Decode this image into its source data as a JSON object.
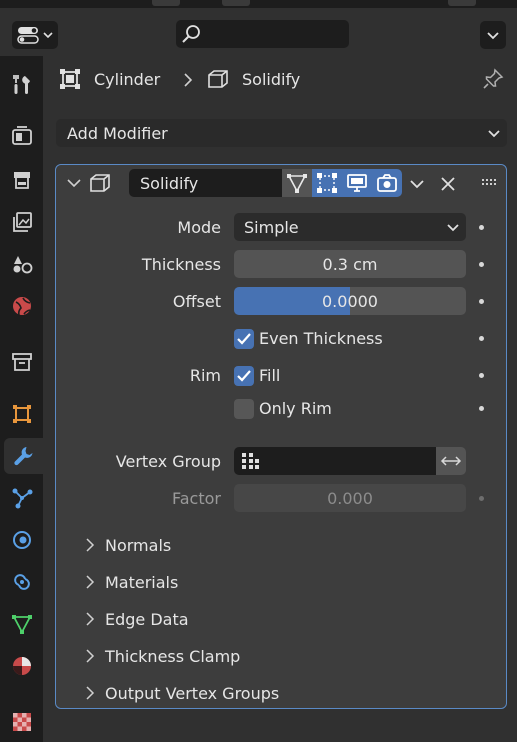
{
  "breadcrumb": {
    "object": "Cylinder",
    "modifier": "Solidify"
  },
  "add_modifier_label": "Add Modifier",
  "modifier": {
    "name": "Solidify",
    "mode_label": "Mode",
    "mode_value": "Simple",
    "thickness_label": "Thickness",
    "thickness_value": "0.3 cm",
    "offset_label": "Offset",
    "offset_value": "0.0000",
    "offset_fill": 0.5,
    "even_thickness_label": "Even Thickness",
    "even_thickness_checked": true,
    "rim_label": "Rim",
    "fill_label": "Fill",
    "fill_checked": true,
    "only_rim_label": "Only Rim",
    "only_rim_checked": false,
    "vertex_group_label": "Vertex Group",
    "vertex_group_value": "",
    "factor_label": "Factor",
    "factor_value": "0.000",
    "subpanels": [
      "Normals",
      "Materials",
      "Edge Data",
      "Thickness Clamp",
      "Output Vertex Groups"
    ]
  },
  "colors": {
    "accent": "#4772b3",
    "panel_border": "#5a8ac6",
    "background": "#303030",
    "sidebar": "#1d1d1d"
  }
}
